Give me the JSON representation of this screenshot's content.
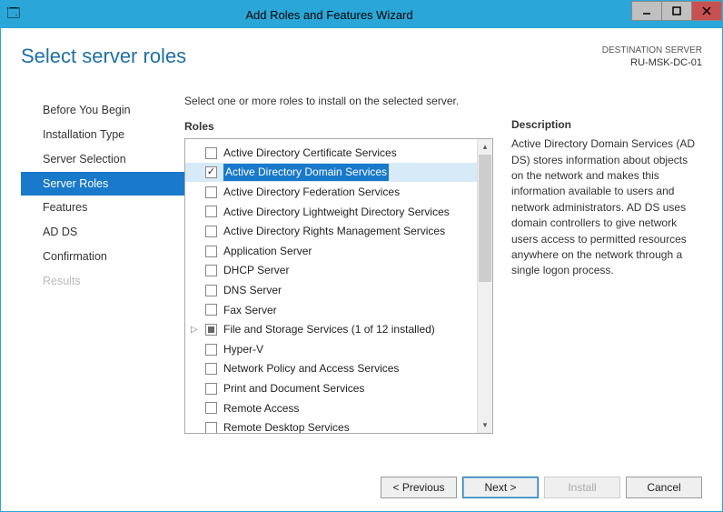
{
  "window": {
    "title": "Add Roles and Features Wizard"
  },
  "header": {
    "page_title": "Select server roles",
    "destination_label": "DESTINATION SERVER",
    "destination_server": "RU-MSK-DC-01"
  },
  "nav": {
    "items": [
      {
        "label": "Before You Begin",
        "state": "normal"
      },
      {
        "label": "Installation Type",
        "state": "normal"
      },
      {
        "label": "Server Selection",
        "state": "normal"
      },
      {
        "label": "Server Roles",
        "state": "selected"
      },
      {
        "label": "Features",
        "state": "normal"
      },
      {
        "label": "AD DS",
        "state": "normal"
      },
      {
        "label": "Confirmation",
        "state": "normal"
      },
      {
        "label": "Results",
        "state": "disabled"
      }
    ]
  },
  "content": {
    "instruction": "Select one or more roles to install on the selected server.",
    "roles_label": "Roles",
    "roles": [
      {
        "label": "Active Directory Certificate Services",
        "checked": false
      },
      {
        "label": "Active Directory Domain Services",
        "checked": true,
        "selected": true
      },
      {
        "label": "Active Directory Federation Services",
        "checked": false
      },
      {
        "label": "Active Directory Lightweight Directory Services",
        "checked": false
      },
      {
        "label": "Active Directory Rights Management Services",
        "checked": false
      },
      {
        "label": "Application Server",
        "checked": false
      },
      {
        "label": "DHCP Server",
        "checked": false
      },
      {
        "label": "DNS Server",
        "checked": false
      },
      {
        "label": "Fax Server",
        "checked": false
      },
      {
        "label": "File and Storage Services (1 of 12 installed)",
        "checked": false,
        "partial": true,
        "expandable": true
      },
      {
        "label": "Hyper-V",
        "checked": false
      },
      {
        "label": "Network Policy and Access Services",
        "checked": false
      },
      {
        "label": "Print and Document Services",
        "checked": false
      },
      {
        "label": "Remote Access",
        "checked": false
      },
      {
        "label": "Remote Desktop Services",
        "checked": false
      }
    ]
  },
  "description": {
    "label": "Description",
    "text": "Active Directory Domain Services (AD DS) stores information about objects on the network and makes this information available to users and network administrators. AD DS uses domain controllers to give network users access to permitted resources anywhere on the network through a single logon process."
  },
  "footer": {
    "previous": "< Previous",
    "next": "Next >",
    "install": "Install",
    "cancel": "Cancel"
  }
}
